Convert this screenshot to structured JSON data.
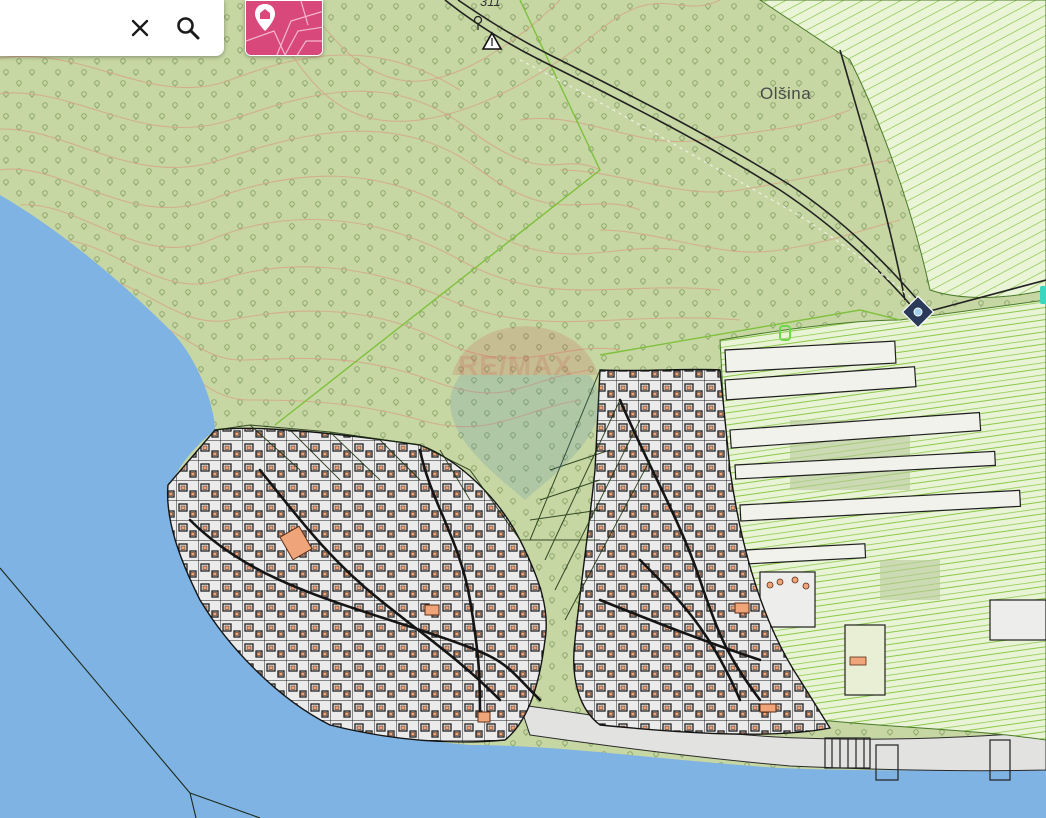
{
  "search": {
    "placeholder": "",
    "value": ""
  },
  "buttons": {
    "clear_icon": "close-icon",
    "search_icon": "search-icon",
    "layer_icon": "map-pin-icon"
  },
  "map": {
    "place_name": "Olšina",
    "elevation_label": "311",
    "watermark": "RE/MAX"
  },
  "colors": {
    "forest": "#c6d7a3",
    "sea": "#7fb3e3",
    "contours": "#d6a78a",
    "vineyard": "#a8d86a",
    "parcel_lines": "#1f1f1f",
    "buildings": "#f0a479",
    "accent": "#d9487a"
  }
}
